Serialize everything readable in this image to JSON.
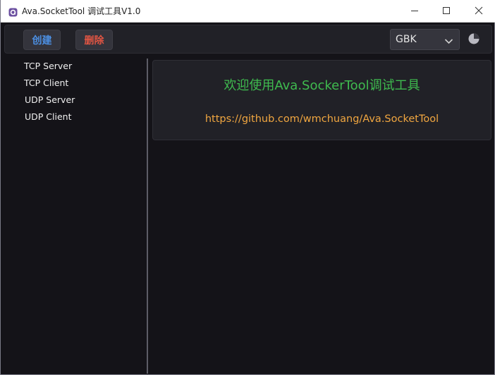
{
  "window": {
    "title": "Ava.SocketTool 调试工具V1.0",
    "app_icon": "app-logo-icon",
    "controls": [
      "minimize-icon",
      "maximize-icon",
      "close-icon"
    ]
  },
  "toolbar": {
    "create_label": "创建",
    "delete_label": "删除",
    "encoding": {
      "selected": "GBK"
    },
    "theme_icon": "theme-toggle-icon"
  },
  "sidebar": {
    "items": [
      {
        "label": "TCP Server"
      },
      {
        "label": "TCP Client"
      },
      {
        "label": "UDP Server"
      },
      {
        "label": "UDP Client"
      }
    ]
  },
  "main": {
    "welcome_title": "欢迎使用Ava.SockerTool调试工具",
    "link": "https://github.com/wmchuang/Ava.SocketTool"
  },
  "colors": {
    "background": "#141318",
    "panel": "#212127",
    "create_text": "#4c8fe2",
    "delete_text": "#e05543",
    "welcome_text": "#3fbb4f",
    "link_text": "#f0a640"
  }
}
